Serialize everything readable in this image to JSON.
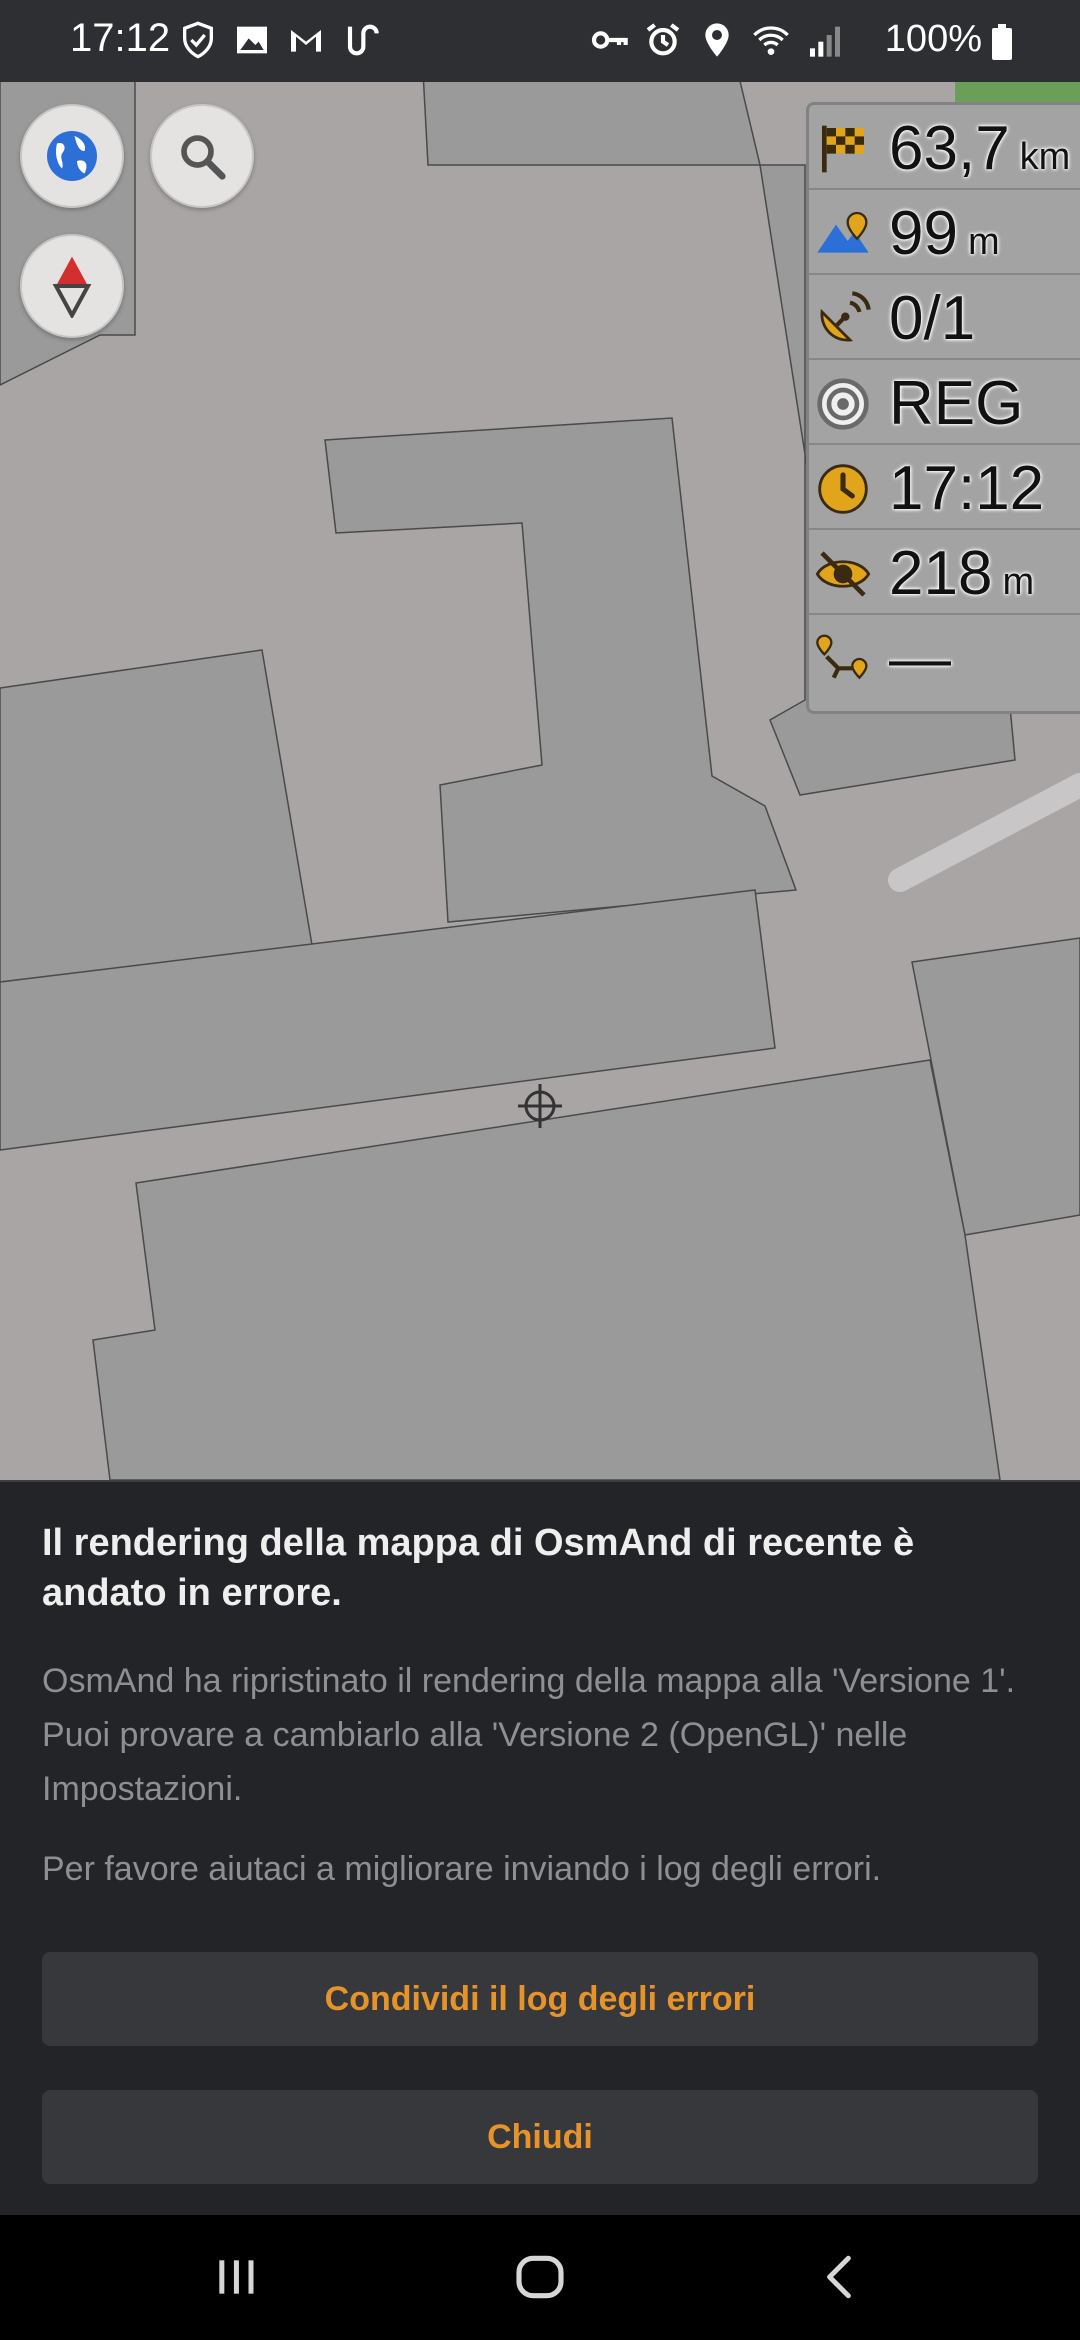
{
  "status_bar": {
    "time": "17:12",
    "battery_percent": "100%",
    "left_icons": [
      "shield-icon",
      "image-icon",
      "gmail-icon",
      "route-icon"
    ],
    "right_icons": [
      "key-icon",
      "alarm-icon",
      "location-icon",
      "wifi-icon",
      "signal-icon",
      "battery-icon"
    ]
  },
  "map": {
    "background_color": "#a9a5a5",
    "building_color": "#9a9a9a",
    "park_color": "#6a9e59"
  },
  "map_controls": {
    "layers_button_icon": "globe-icon",
    "search_button_icon": "search-icon",
    "compass_button_icon": "compass-icon"
  },
  "widgets": [
    {
      "icon": "finish-flag-icon",
      "value": "63,7",
      "unit": "km"
    },
    {
      "icon": "altitude-icon",
      "value": "99",
      "unit": "m"
    },
    {
      "icon": "satellite-icon",
      "value": "0/1",
      "unit": ""
    },
    {
      "icon": "gps-target-icon",
      "value": "REG",
      "unit": ""
    },
    {
      "icon": "clock-icon",
      "value": "17:12",
      "unit": ""
    },
    {
      "icon": "eye-hidden-icon",
      "value": "218",
      "unit": "m"
    },
    {
      "icon": "accuracy-icon",
      "value": "—",
      "unit": ""
    }
  ],
  "dialog": {
    "title": "Il rendering della mappa di OsmAnd di recente è andato in errore.",
    "body_1": "OsmAnd ha ripristinato il rendering della mappa alla 'Versione 1'. Puoi provare a cambiarlo alla 'Versione 2 (OpenGL)' nelle Impostazioni.",
    "body_2": "Per favore aiutaci a migliorare inviando i log degli errori.",
    "share_button": "Condividi il log degli errori",
    "close_button": "Chiudi",
    "accent_color": "#e6932a"
  },
  "nav_bar": {
    "recents_icon": "recents-icon",
    "home_icon": "home-icon",
    "back_icon": "back-icon"
  }
}
